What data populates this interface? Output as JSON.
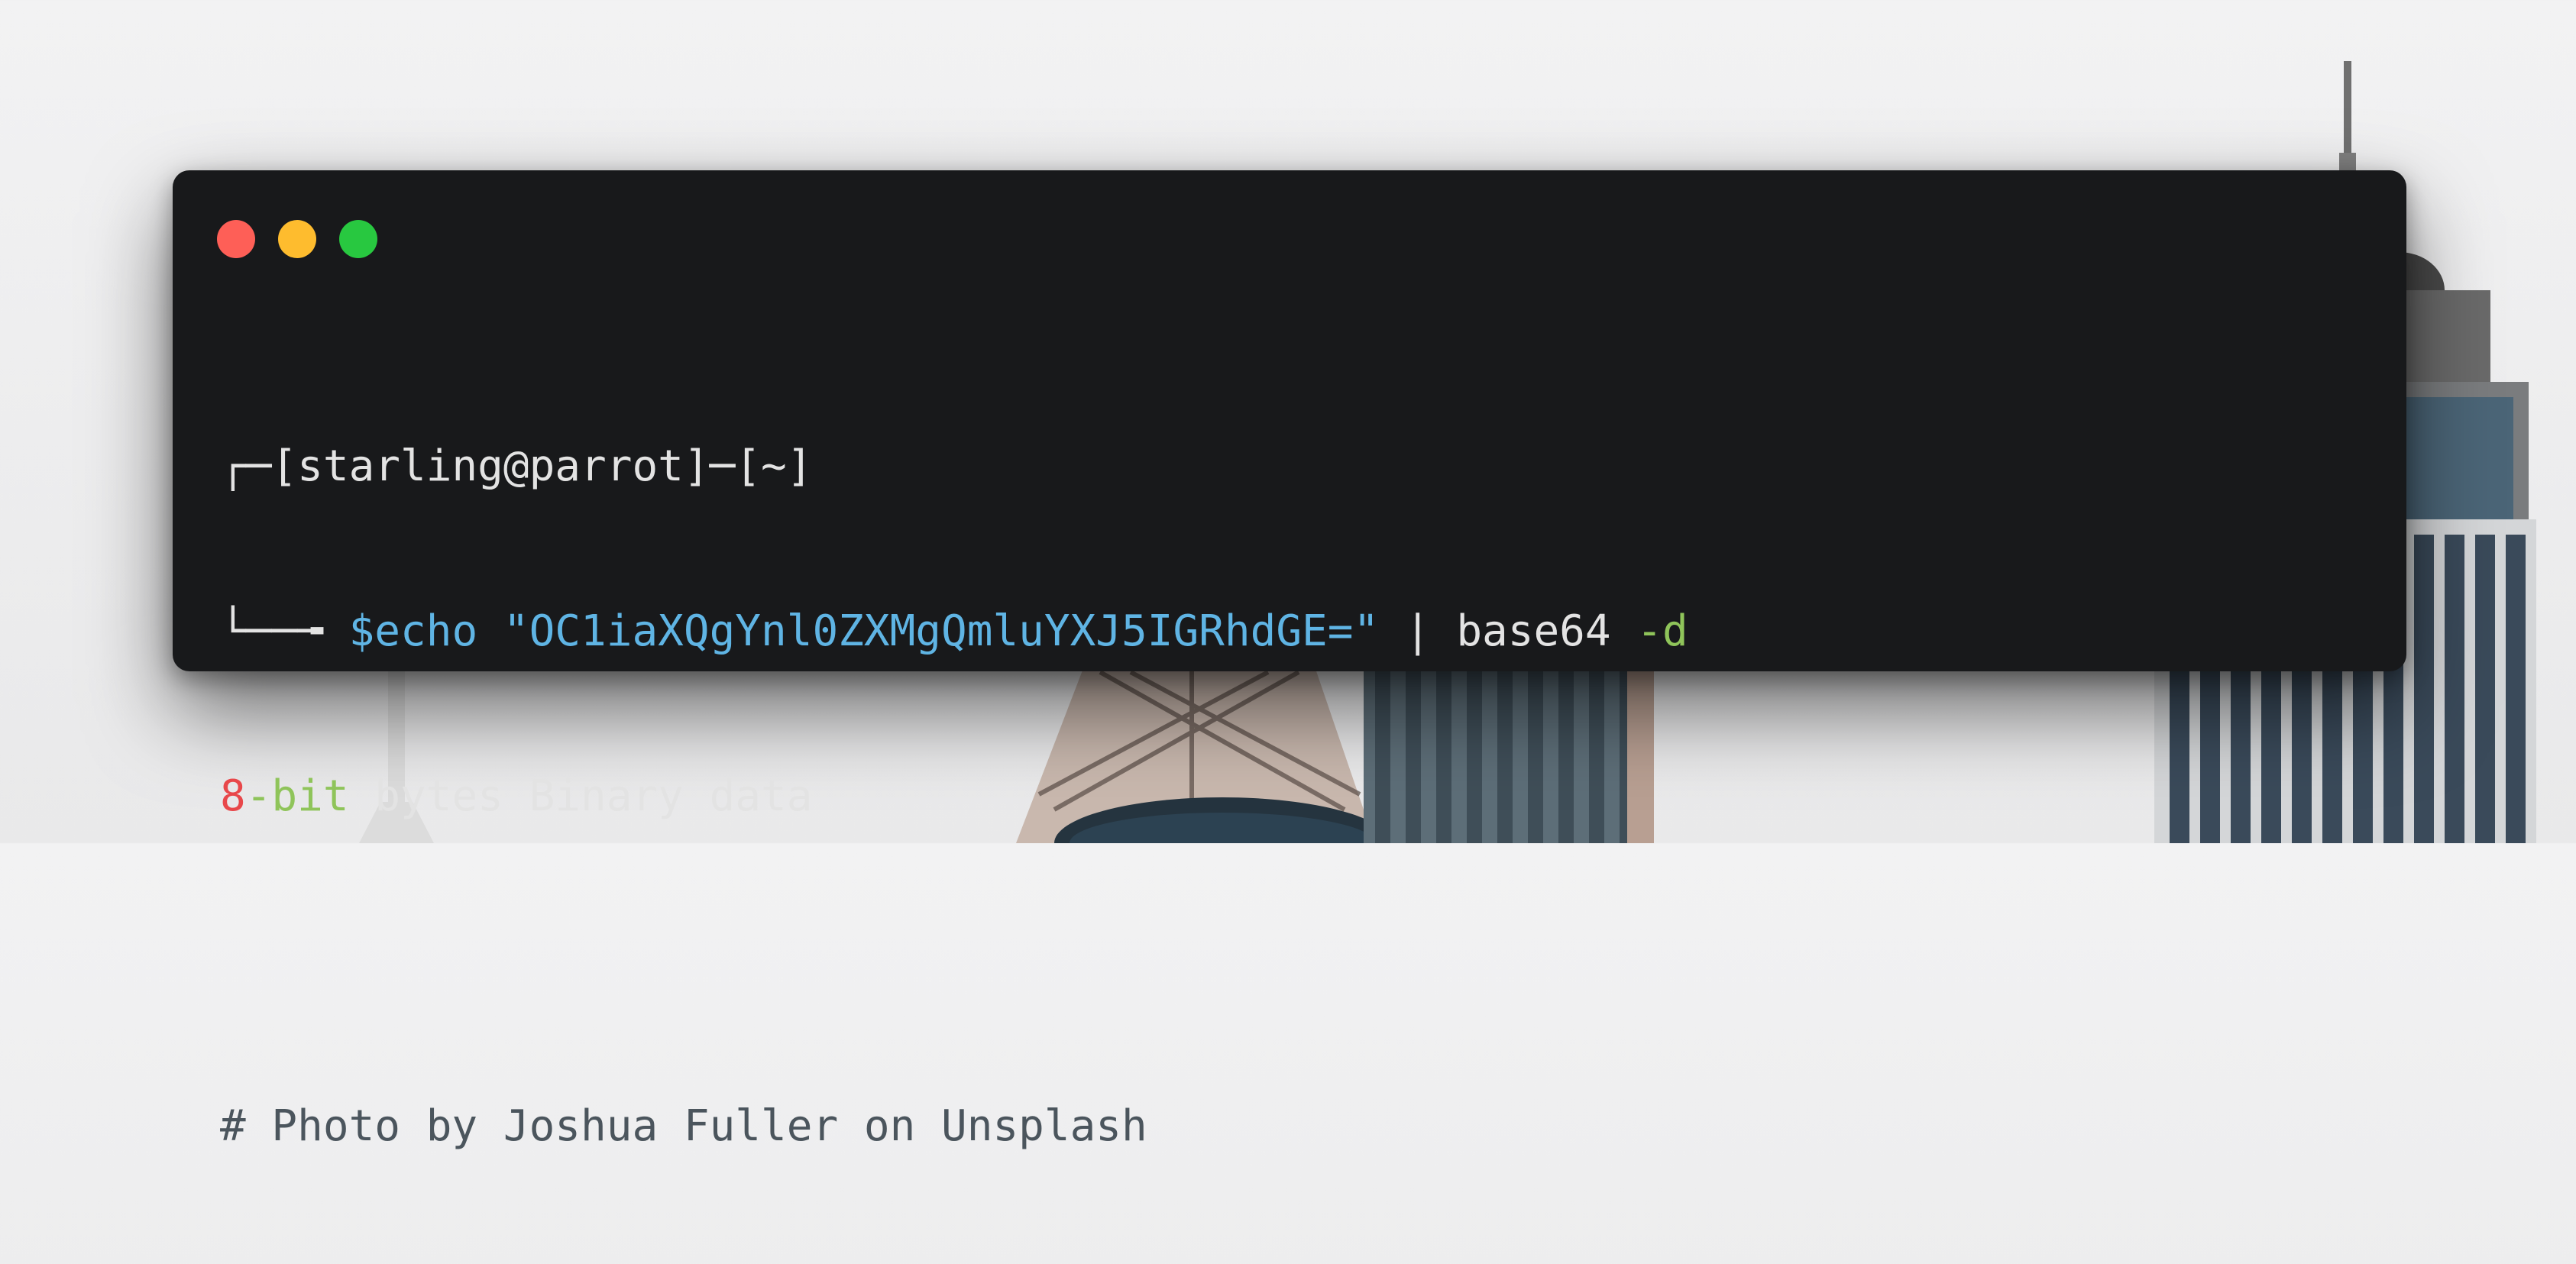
{
  "window": {
    "buttons": [
      "close",
      "minimize",
      "maximize"
    ],
    "colors": {
      "close": "#fe5f57",
      "minimize": "#febc2e",
      "maximize": "#28c840",
      "background": "#18191b"
    }
  },
  "terminal": {
    "prompt_line": "┌─[starling@parrot]─[~]",
    "command_prefix": "└──╼ ",
    "command": "$echo \"OC1iaXQgYnl0ZXMgQmluYXJ5IGRhdGE=\"",
    "pipe": " | base64 ",
    "flag": "-d",
    "output_num": "8",
    "output_bit": "-bit",
    "output_rest": " bytes Binary data",
    "comment": "# Photo by Joshua Fuller on Unsplash"
  }
}
